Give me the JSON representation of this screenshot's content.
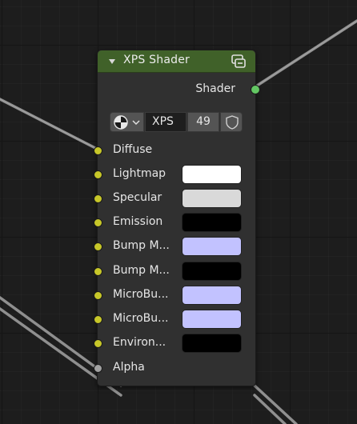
{
  "node": {
    "title": "XPS Shader",
    "header_color": "#406129",
    "collapse_icon": "triangle-down-icon",
    "group_icon": "node-group-icon",
    "output": {
      "label": "Shader",
      "socket_color": "#63c763"
    },
    "datablock": {
      "type_icon": "material-sphere-icon",
      "name": "XPS",
      "users": "49",
      "fake_user_icon": "shield-icon"
    },
    "inputs": [
      {
        "label": "Diffuse",
        "socket": "color",
        "swatch": null
      },
      {
        "label": "Lightmap",
        "socket": "color",
        "swatch": "#ffffff"
      },
      {
        "label": "Specular",
        "socket": "color",
        "swatch": "#d9d9d9"
      },
      {
        "label": "Emission",
        "socket": "color",
        "swatch": "#000000"
      },
      {
        "label": "Bump M...",
        "socket": "color",
        "swatch": "#c2c2ff"
      },
      {
        "label": "Bump M...",
        "socket": "color",
        "swatch": "#000000"
      },
      {
        "label": "MicroBu...",
        "socket": "color",
        "swatch": "#c2c2ff"
      },
      {
        "label": "MicroBu...",
        "socket": "color",
        "swatch": "#c2c2ff"
      },
      {
        "label": "Environ...",
        "socket": "color",
        "swatch": "#000000"
      },
      {
        "label": "Alpha",
        "socket": "value",
        "swatch": null
      }
    ]
  },
  "colors": {
    "color_socket": "#c7c729",
    "value_socket": "#a1a1a1",
    "background": "#1d1d1d"
  }
}
